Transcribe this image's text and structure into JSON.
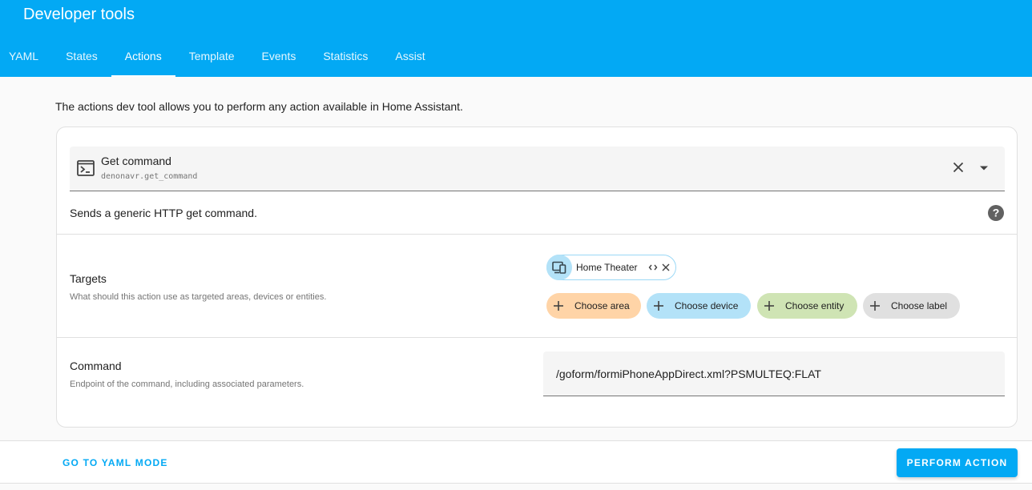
{
  "header": {
    "title": "Developer tools",
    "tabs": [
      {
        "label": "YAML"
      },
      {
        "label": "States"
      },
      {
        "label": "Actions",
        "active": true
      },
      {
        "label": "Template"
      },
      {
        "label": "Events"
      },
      {
        "label": "Statistics"
      },
      {
        "label": "Assist"
      }
    ]
  },
  "intro": "The actions dev tool allows you to perform any action available in Home Assistant.",
  "action": {
    "name": "Get command",
    "id": "denonavr.get_command",
    "icon": "console-icon",
    "description": "Sends a generic HTTP get command."
  },
  "targets": {
    "label": "Targets",
    "description": "What should this action use as targeted areas, devices or entities.",
    "selected_device": {
      "label": "Home Theater",
      "icon": "devices-icon"
    },
    "add_buttons": {
      "area": "Choose area",
      "device": "Choose device",
      "entity": "Choose entity",
      "label": "Choose label"
    }
  },
  "command": {
    "label": "Command",
    "description": "Endpoint of the command, including associated parameters.",
    "value": "/goform/formiPhoneAppDirect.xml?PSMULTEQ:FLAT"
  },
  "footer": {
    "yaml_mode": "GO TO YAML MODE",
    "perform": "PERFORM ACTION"
  },
  "colors": {
    "primary": "#03a9f4",
    "area": "#ffd4a7",
    "device": "#b3e2f8",
    "entity": "#cfe4b4",
    "label": "#e0e0e0"
  }
}
